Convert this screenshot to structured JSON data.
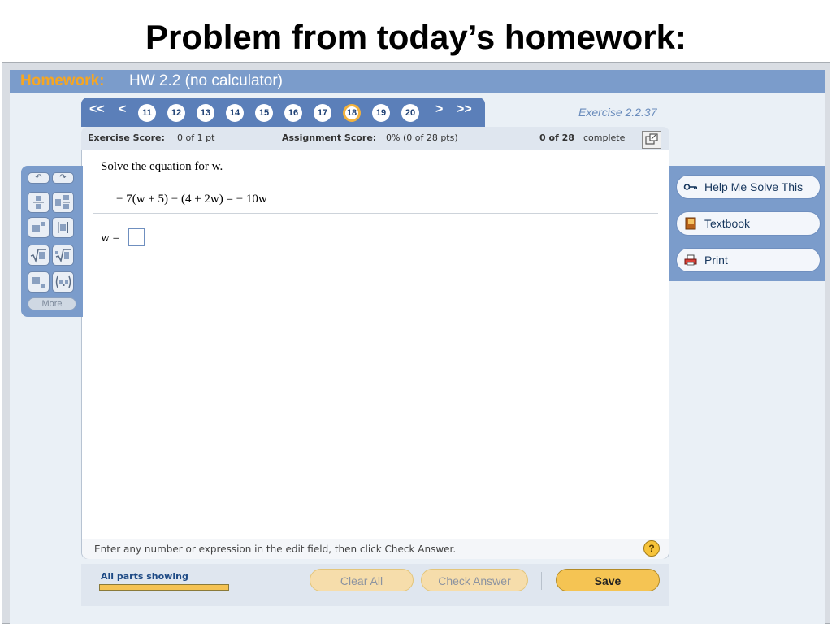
{
  "slide": {
    "title": "Problem from today’s homework:"
  },
  "header": {
    "prefix": "Homework:",
    "assignment": "HW 2.2 (no calculator)"
  },
  "nav": {
    "first": "<<",
    "prev": "<",
    "next": ">",
    "last": ">>",
    "questions": [
      "11",
      "12",
      "13",
      "14",
      "15",
      "16",
      "17",
      "18",
      "19",
      "20"
    ],
    "current": "18",
    "exercise_id": "Exercise 2.2.37"
  },
  "scores": {
    "exercise_label": "Exercise Score:",
    "exercise_value": "0 of 1 pt",
    "assignment_label": "Assignment Score:",
    "assignment_value": "0% (0 of 28 pts)",
    "complete_count": "0 of 28",
    "complete_label": "complete"
  },
  "problem": {
    "prompt": "Solve the equation for w.",
    "equation": "− 7(w + 5) − (4 + 2w) = − 10w",
    "answer_label": "w =",
    "answer_value": ""
  },
  "hint": {
    "text": "Enter any number or expression in the edit field, then click Check Answer.",
    "help_glyph": "?"
  },
  "bottom": {
    "parts_label": "All parts showing",
    "parts_progress": 1.0,
    "clear_all": "Clear All",
    "check_answer": "Check Answer",
    "save": "Save"
  },
  "toolbox": {
    "undo": "↶",
    "redo": "↷",
    "tools": [
      "fraction-icon",
      "mixed-number-icon",
      "exponent-icon",
      "absolute-value-icon",
      "sqrt-icon",
      "nth-root-icon",
      "subscript-icon",
      "ordered-pair-icon"
    ],
    "more": "More"
  },
  "side": {
    "help_me": "Help Me Solve This",
    "textbook": "Textbook",
    "print": "Print"
  },
  "colors": {
    "accent": "#f5a623",
    "header": "#7b9ccb",
    "nav": "#5b7fb9",
    "save": "#f5c453"
  }
}
